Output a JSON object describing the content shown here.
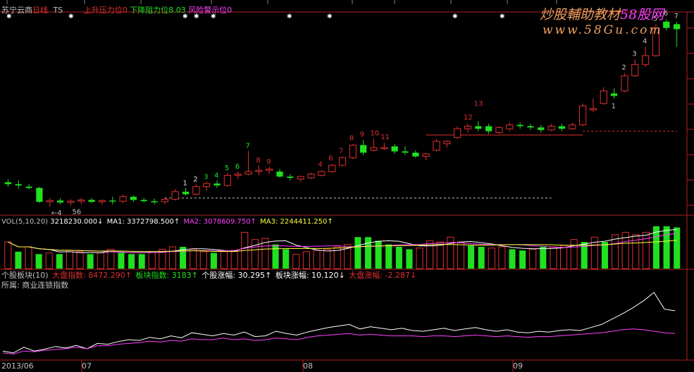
{
  "colors": {
    "background": "#000000",
    "up": "#e03030",
    "down": "#20e020",
    "panel_border": "#b02020",
    "text_gray": "#c0c0c0",
    "magenta": "#ff40ff",
    "yellow": "#ffff40",
    "white": "#ffffff"
  },
  "watermark": {
    "line1_a": "炒股輔助教材",
    "line1_b": "58股网",
    "line2": "www.58Gu.com"
  },
  "header": {
    "stock_name": "苏宁云商",
    "period": "日线",
    "ts": "TS",
    "ind1": "上升压力位0",
    "ind2": "下降阻力位8.03",
    "ind3": "风险警示位0"
  },
  "vol_header": {
    "label": "VOL(5,10,20)",
    "vol": "3218230.000↓",
    "ma1": "MA1: 3372798.500↑",
    "ma2": "MA2: 3078609.750↑",
    "ma3": "MA3: 2244411.250↑"
  },
  "sector_header": {
    "label": "个股板块(10)",
    "item1": "大盘指数: 8472.290↑",
    "item2": "板块指数: 3183↑",
    "item3": "个股涨幅: 30.295↑",
    "item4": "板块涨幅: 10.120↓",
    "item5": "大盘涨幅: -2.287↓",
    "sector_name": "所属: 商业连锁指数"
  },
  "x_axis": {
    "labels": [
      "2013/06",
      "07",
      "08",
      "09"
    ]
  },
  "chart_data": [
    {
      "type": "candlestick",
      "title": "苏宁云商 日线",
      "candles": [
        {
          "o": 4.95,
          "h": 5.0,
          "l": 4.88,
          "c": 4.92
        },
        {
          "o": 4.92,
          "h": 4.98,
          "l": 4.85,
          "c": 4.9
        },
        {
          "o": 4.88,
          "h": 4.92,
          "l": 4.84,
          "c": 4.86
        },
        {
          "o": 4.86,
          "h": 4.88,
          "l": 4.62,
          "c": 4.64
        },
        {
          "o": 4.64,
          "h": 4.7,
          "l": 4.56,
          "c": 4.66
        },
        {
          "o": 4.66,
          "h": 4.7,
          "l": 4.6,
          "c": 4.63
        },
        {
          "o": 4.63,
          "h": 4.68,
          "l": 4.58,
          "c": 4.65
        },
        {
          "o": 4.65,
          "h": 4.7,
          "l": 4.6,
          "c": 4.67
        },
        {
          "o": 4.67,
          "h": 4.7,
          "l": 4.62,
          "c": 4.64
        },
        {
          "o": 4.64,
          "h": 4.68,
          "l": 4.6,
          "c": 4.66
        },
        {
          "o": 4.66,
          "h": 4.72,
          "l": 4.6,
          "c": 4.65
        },
        {
          "o": 4.65,
          "h": 4.76,
          "l": 4.62,
          "c": 4.72
        },
        {
          "o": 4.72,
          "h": 4.74,
          "l": 4.64,
          "c": 4.67
        },
        {
          "o": 4.67,
          "h": 4.7,
          "l": 4.63,
          "c": 4.65
        },
        {
          "o": 4.65,
          "h": 4.69,
          "l": 4.6,
          "c": 4.64
        },
        {
          "o": 4.64,
          "h": 4.7,
          "l": 4.6,
          "c": 4.68
        },
        {
          "o": 4.68,
          "h": 4.84,
          "l": 4.66,
          "c": 4.8
        },
        {
          "o": 4.8,
          "h": 4.86,
          "l": 4.74,
          "c": 4.76
        },
        {
          "o": 4.76,
          "h": 4.92,
          "l": 4.74,
          "c": 4.88
        },
        {
          "o": 4.88,
          "h": 4.96,
          "l": 4.82,
          "c": 4.93
        },
        {
          "o": 4.93,
          "h": 4.98,
          "l": 4.86,
          "c": 4.9
        },
        {
          "o": 4.9,
          "h": 5.1,
          "l": 4.88,
          "c": 5.06
        },
        {
          "o": 5.06,
          "h": 5.12,
          "l": 5.0,
          "c": 5.08
        },
        {
          "o": 5.08,
          "h": 5.45,
          "l": 5.06,
          "c": 5.12
        },
        {
          "o": 5.12,
          "h": 5.22,
          "l": 5.06,
          "c": 5.14
        },
        {
          "o": 5.14,
          "h": 5.2,
          "l": 5.08,
          "c": 5.16
        },
        {
          "o": 5.12,
          "h": 5.16,
          "l": 5.02,
          "c": 5.04
        },
        {
          "o": 5.04,
          "h": 5.08,
          "l": 4.98,
          "c": 5.02
        },
        {
          "o": 5.0,
          "h": 5.06,
          "l": 4.96,
          "c": 5.04
        },
        {
          "o": 5.02,
          "h": 5.1,
          "l": 5.0,
          "c": 5.08
        },
        {
          "o": 5.06,
          "h": 5.14,
          "l": 5.04,
          "c": 5.12
        },
        {
          "o": 5.12,
          "h": 5.24,
          "l": 5.1,
          "c": 5.22
        },
        {
          "o": 5.22,
          "h": 5.36,
          "l": 5.2,
          "c": 5.34
        },
        {
          "o": 5.34,
          "h": 5.56,
          "l": 5.32,
          "c": 5.54
        },
        {
          "o": 5.54,
          "h": 5.62,
          "l": 5.38,
          "c": 5.42
        },
        {
          "o": 5.46,
          "h": 5.64,
          "l": 5.44,
          "c": 5.5
        },
        {
          "o": 5.5,
          "h": 5.58,
          "l": 5.46,
          "c": 5.5
        },
        {
          "o": 5.52,
          "h": 5.56,
          "l": 5.4,
          "c": 5.44
        },
        {
          "o": 5.44,
          "h": 5.52,
          "l": 5.38,
          "c": 5.42
        },
        {
          "o": 5.42,
          "h": 5.46,
          "l": 5.34,
          "c": 5.36
        },
        {
          "o": 5.36,
          "h": 5.42,
          "l": 5.3,
          "c": 5.4
        },
        {
          "o": 5.46,
          "h": 5.64,
          "l": 5.44,
          "c": 5.6
        },
        {
          "o": 5.56,
          "h": 5.62,
          "l": 5.5,
          "c": 5.6
        },
        {
          "o": 5.66,
          "h": 5.84,
          "l": 5.64,
          "c": 5.8
        },
        {
          "o": 5.8,
          "h": 5.88,
          "l": 5.74,
          "c": 5.84
        },
        {
          "o": 5.84,
          "h": 5.92,
          "l": 5.76,
          "c": 5.8
        },
        {
          "o": 5.84,
          "h": 5.88,
          "l": 5.72,
          "c": 5.76
        },
        {
          "o": 5.74,
          "h": 5.84,
          "l": 5.72,
          "c": 5.82
        },
        {
          "o": 5.8,
          "h": 5.9,
          "l": 5.76,
          "c": 5.86
        },
        {
          "o": 5.86,
          "h": 5.9,
          "l": 5.8,
          "c": 5.84
        },
        {
          "o": 5.84,
          "h": 5.88,
          "l": 5.78,
          "c": 5.82
        },
        {
          "o": 5.82,
          "h": 5.86,
          "l": 5.74,
          "c": 5.78
        },
        {
          "o": 5.78,
          "h": 5.88,
          "l": 5.76,
          "c": 5.84
        },
        {
          "o": 5.84,
          "h": 5.88,
          "l": 5.76,
          "c": 5.8
        },
        {
          "o": 5.8,
          "h": 5.9,
          "l": 5.78,
          "c": 5.86
        },
        {
          "o": 5.86,
          "h": 6.2,
          "l": 5.84,
          "c": 6.16
        },
        {
          "o": 6.1,
          "h": 6.28,
          "l": 6.06,
          "c": 6.12
        },
        {
          "o": 6.2,
          "h": 6.46,
          "l": 6.18,
          "c": 6.4
        },
        {
          "o": 6.36,
          "h": 6.44,
          "l": 6.28,
          "c": 6.32
        },
        {
          "o": 6.4,
          "h": 6.68,
          "l": 6.38,
          "c": 6.64
        },
        {
          "o": 6.64,
          "h": 6.9,
          "l": 6.62,
          "c": 6.82
        },
        {
          "o": 6.82,
          "h": 7.1,
          "l": 6.78,
          "c": 6.96
        },
        {
          "o": 6.96,
          "h": 7.46,
          "l": 6.94,
          "c": 7.4
        },
        {
          "o": 7.5,
          "h": 7.54,
          "l": 7.36,
          "c": 7.4
        },
        {
          "o": 7.46,
          "h": 7.5,
          "l": 7.1,
          "c": 7.38
        }
      ],
      "annotations": {
        "early_counts": [
          "1",
          "2",
          "3",
          "4",
          "5",
          "6",
          "7",
          "8",
          "9"
        ],
        "mid_counts": [
          "4",
          "6",
          "7",
          "8",
          "9",
          "10",
          "11"
        ],
        "late_counts": [
          "12",
          "13"
        ],
        "final_counts": [
          "1",
          "2",
          "3",
          "4",
          "5",
          "6",
          "7"
        ],
        "low_labels": [
          "4",
          "56"
        ]
      },
      "resistance": 5.7,
      "support": 4.7,
      "breakout_support": 5.76
    },
    {
      "type": "bar",
      "title": "VOL(5,10,20)",
      "values": [
        2.2,
        1.4,
        1.8,
        1.2,
        1.3,
        1.2,
        1.5,
        1.4,
        1.2,
        1.3,
        1.6,
        1.3,
        1.2,
        1.2,
        1.4,
        1.6,
        1.8,
        1.8,
        1.6,
        1.4,
        1.3,
        1.4,
        1.5,
        3.0,
        2.4,
        2.5,
        2.0,
        1.6,
        1.2,
        1.4,
        1.5,
        1.6,
        1.8,
        2.0,
        2.6,
        2.6,
        2.3,
        2.0,
        1.8,
        1.6,
        1.7,
        2.3,
        2.2,
        2.6,
        2.2,
        1.9,
        1.8,
        1.7,
        1.8,
        1.6,
        1.5,
        1.6,
        1.8,
        1.8,
        1.9,
        2.4,
        2.2,
        2.6,
        2.2,
        2.8,
        3.0,
        2.8,
        3.0,
        3.5,
        3.5,
        3.4
      ],
      "up_flags": [
        1,
        0,
        1,
        0,
        1,
        0,
        1,
        1,
        0,
        1,
        1,
        0,
        0,
        0,
        1,
        1,
        1,
        0,
        1,
        1,
        0,
        1,
        1,
        1,
        1,
        1,
        0,
        0,
        1,
        1,
        1,
        1,
        1,
        1,
        0,
        0,
        0,
        0,
        0,
        0,
        1,
        1,
        1,
        1,
        1,
        0,
        0,
        1,
        1,
        0,
        0,
        1,
        0,
        1,
        1,
        1,
        0,
        1,
        0,
        1,
        1,
        1,
        1,
        0,
        0,
        0
      ]
    },
    {
      "type": "line",
      "title": "个股板块",
      "series": [
        {
          "name": "个股涨幅",
          "color": "#ffffff",
          "values": [
            0.3,
            0.25,
            0.4,
            0.3,
            0.35,
            0.42,
            0.38,
            0.45,
            0.36,
            0.5,
            0.48,
            0.55,
            0.6,
            0.58,
            0.66,
            0.62,
            0.7,
            0.65,
            0.78,
            0.74,
            0.7,
            0.76,
            0.72,
            0.8,
            0.68,
            0.7,
            0.82,
            0.76,
            0.72,
            0.8,
            0.86,
            0.92,
            0.96,
            1.0,
            0.88,
            0.94,
            0.9,
            0.86,
            0.9,
            0.84,
            0.82,
            0.86,
            0.9,
            0.84,
            0.88,
            0.92,
            0.86,
            0.82,
            0.86,
            0.8,
            0.78,
            0.82,
            0.8,
            0.84,
            0.86,
            0.84,
            0.92,
            1.0,
            1.14,
            1.28,
            1.44,
            1.62,
            1.84,
            1.4,
            1.36
          ]
        },
        {
          "name": "板块涨幅",
          "color": "#ff40ff",
          "values": [
            0.25,
            0.22,
            0.3,
            0.28,
            0.32,
            0.34,
            0.36,
            0.4,
            0.36,
            0.44,
            0.44,
            0.48,
            0.5,
            0.52,
            0.56,
            0.54,
            0.58,
            0.56,
            0.62,
            0.6,
            0.6,
            0.64,
            0.6,
            0.62,
            0.58,
            0.6,
            0.64,
            0.62,
            0.6,
            0.66,
            0.7,
            0.72,
            0.74,
            0.76,
            0.72,
            0.74,
            0.72,
            0.7,
            0.7,
            0.7,
            0.68,
            0.7,
            0.7,
            0.68,
            0.7,
            0.72,
            0.7,
            0.68,
            0.7,
            0.68,
            0.66,
            0.68,
            0.68,
            0.7,
            0.72,
            0.74,
            0.76,
            0.78,
            0.82,
            0.86,
            0.88,
            0.86,
            0.82,
            0.78,
            0.76
          ]
        }
      ]
    }
  ]
}
